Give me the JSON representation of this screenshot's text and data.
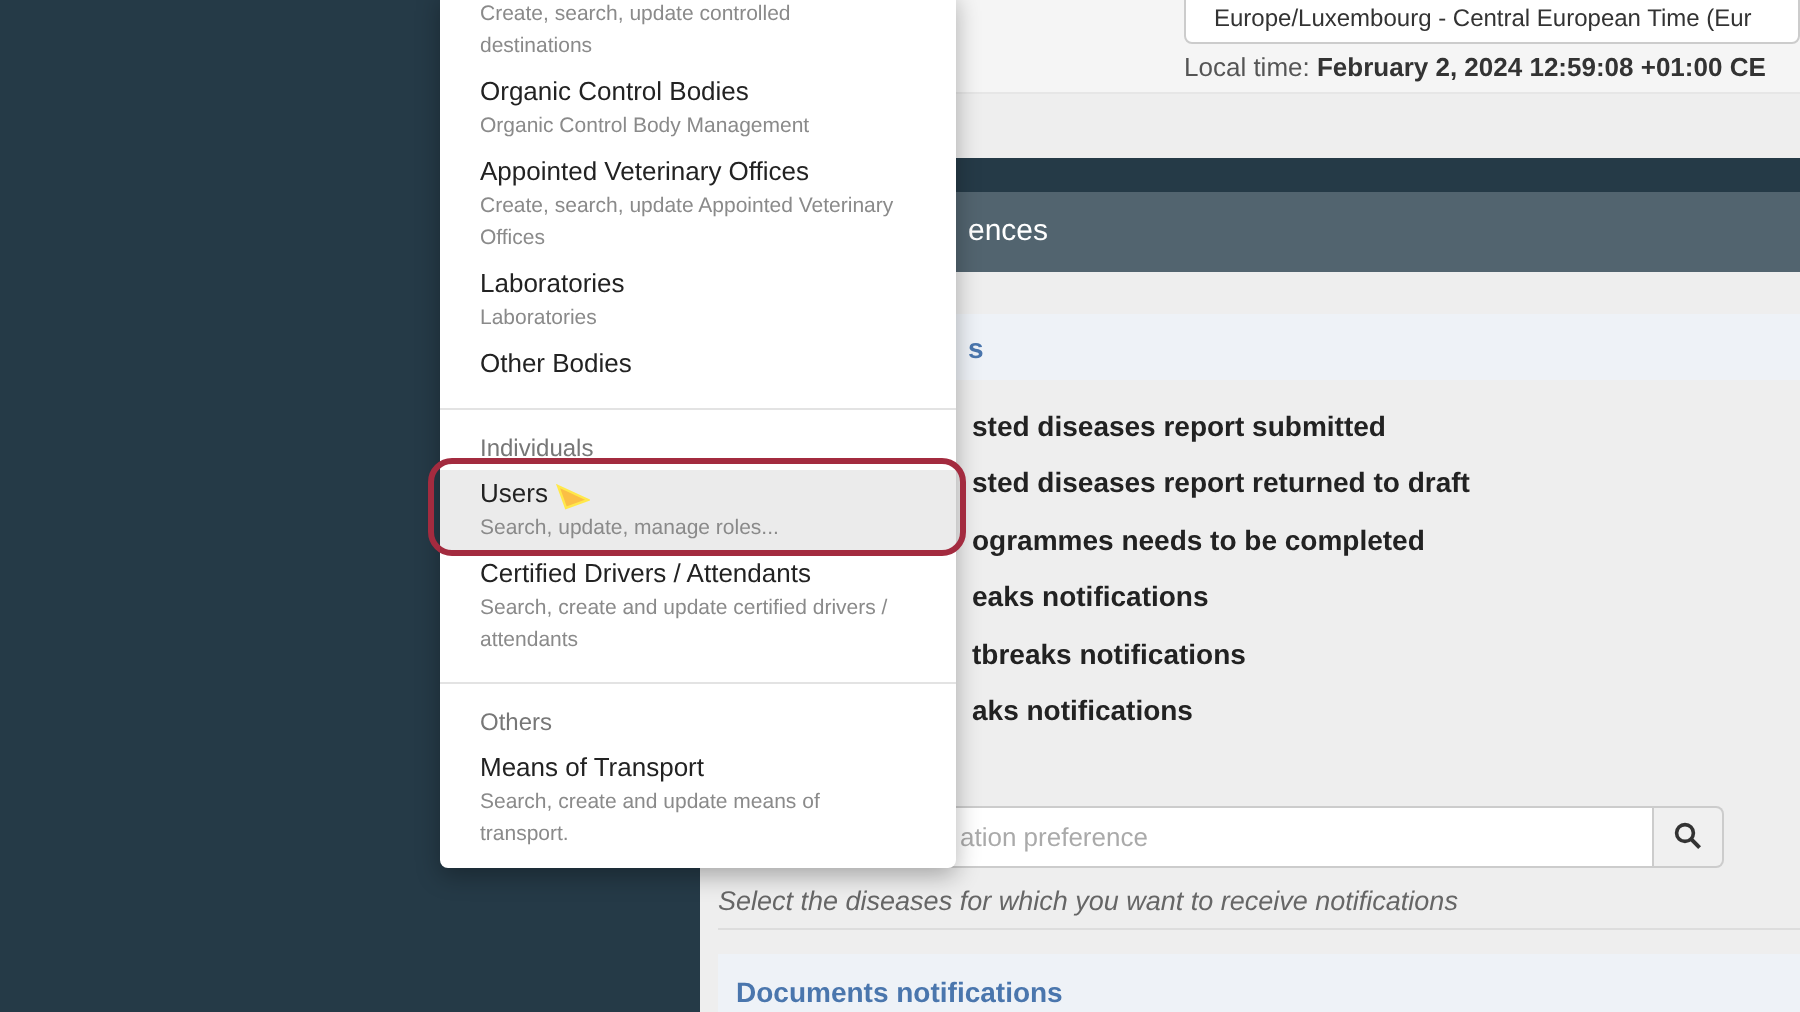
{
  "menu": {
    "sections": [
      {
        "items": [
          {
            "description": "Create, search, update controlled destinations",
            "selected": false
          },
          {
            "title": "Organic Control Bodies",
            "description": "Organic Control Body Management",
            "selected": false
          },
          {
            "title": "Appointed Veterinary Offices",
            "description": "Create, search, update Appointed Veterinary Offices",
            "selected": false
          },
          {
            "title": "Laboratories",
            "description": "Laboratories",
            "selected": false
          },
          {
            "title": "Other Bodies",
            "selected": false
          }
        ]
      },
      {
        "header": "Individuals",
        "items": [
          {
            "title": "Users",
            "description": "Search, update, manage roles...",
            "selected": true
          },
          {
            "title": "Certified Drivers / Attendants",
            "description": "Search, create and update certified drivers / attendants",
            "selected": false
          }
        ]
      },
      {
        "header": "Others",
        "items": [
          {
            "title": "Means of Transport",
            "description": "Search, create and update means of transport.",
            "selected": false
          }
        ]
      }
    ]
  },
  "timezone": {
    "value": "Europe/Luxembourg - Central European Time (Eur"
  },
  "local_time": "Local time: **February 2, 2024 12:59:08 +01:00 CE**",
  "panel": {
    "title": "ences",
    "section_title": "s",
    "notifications": [
      "sted diseases report submitted",
      "sted diseases report returned to draft",
      "ogrammes needs to be completed",
      "eaks notifications",
      "tbreaks notifications",
      "aks notifications"
    ],
    "search": {
      "placeholder": "ation preference"
    },
    "hint": "Select the diseases for which you want to receive notifications",
    "next_section_title": "Documents notifications"
  }
}
